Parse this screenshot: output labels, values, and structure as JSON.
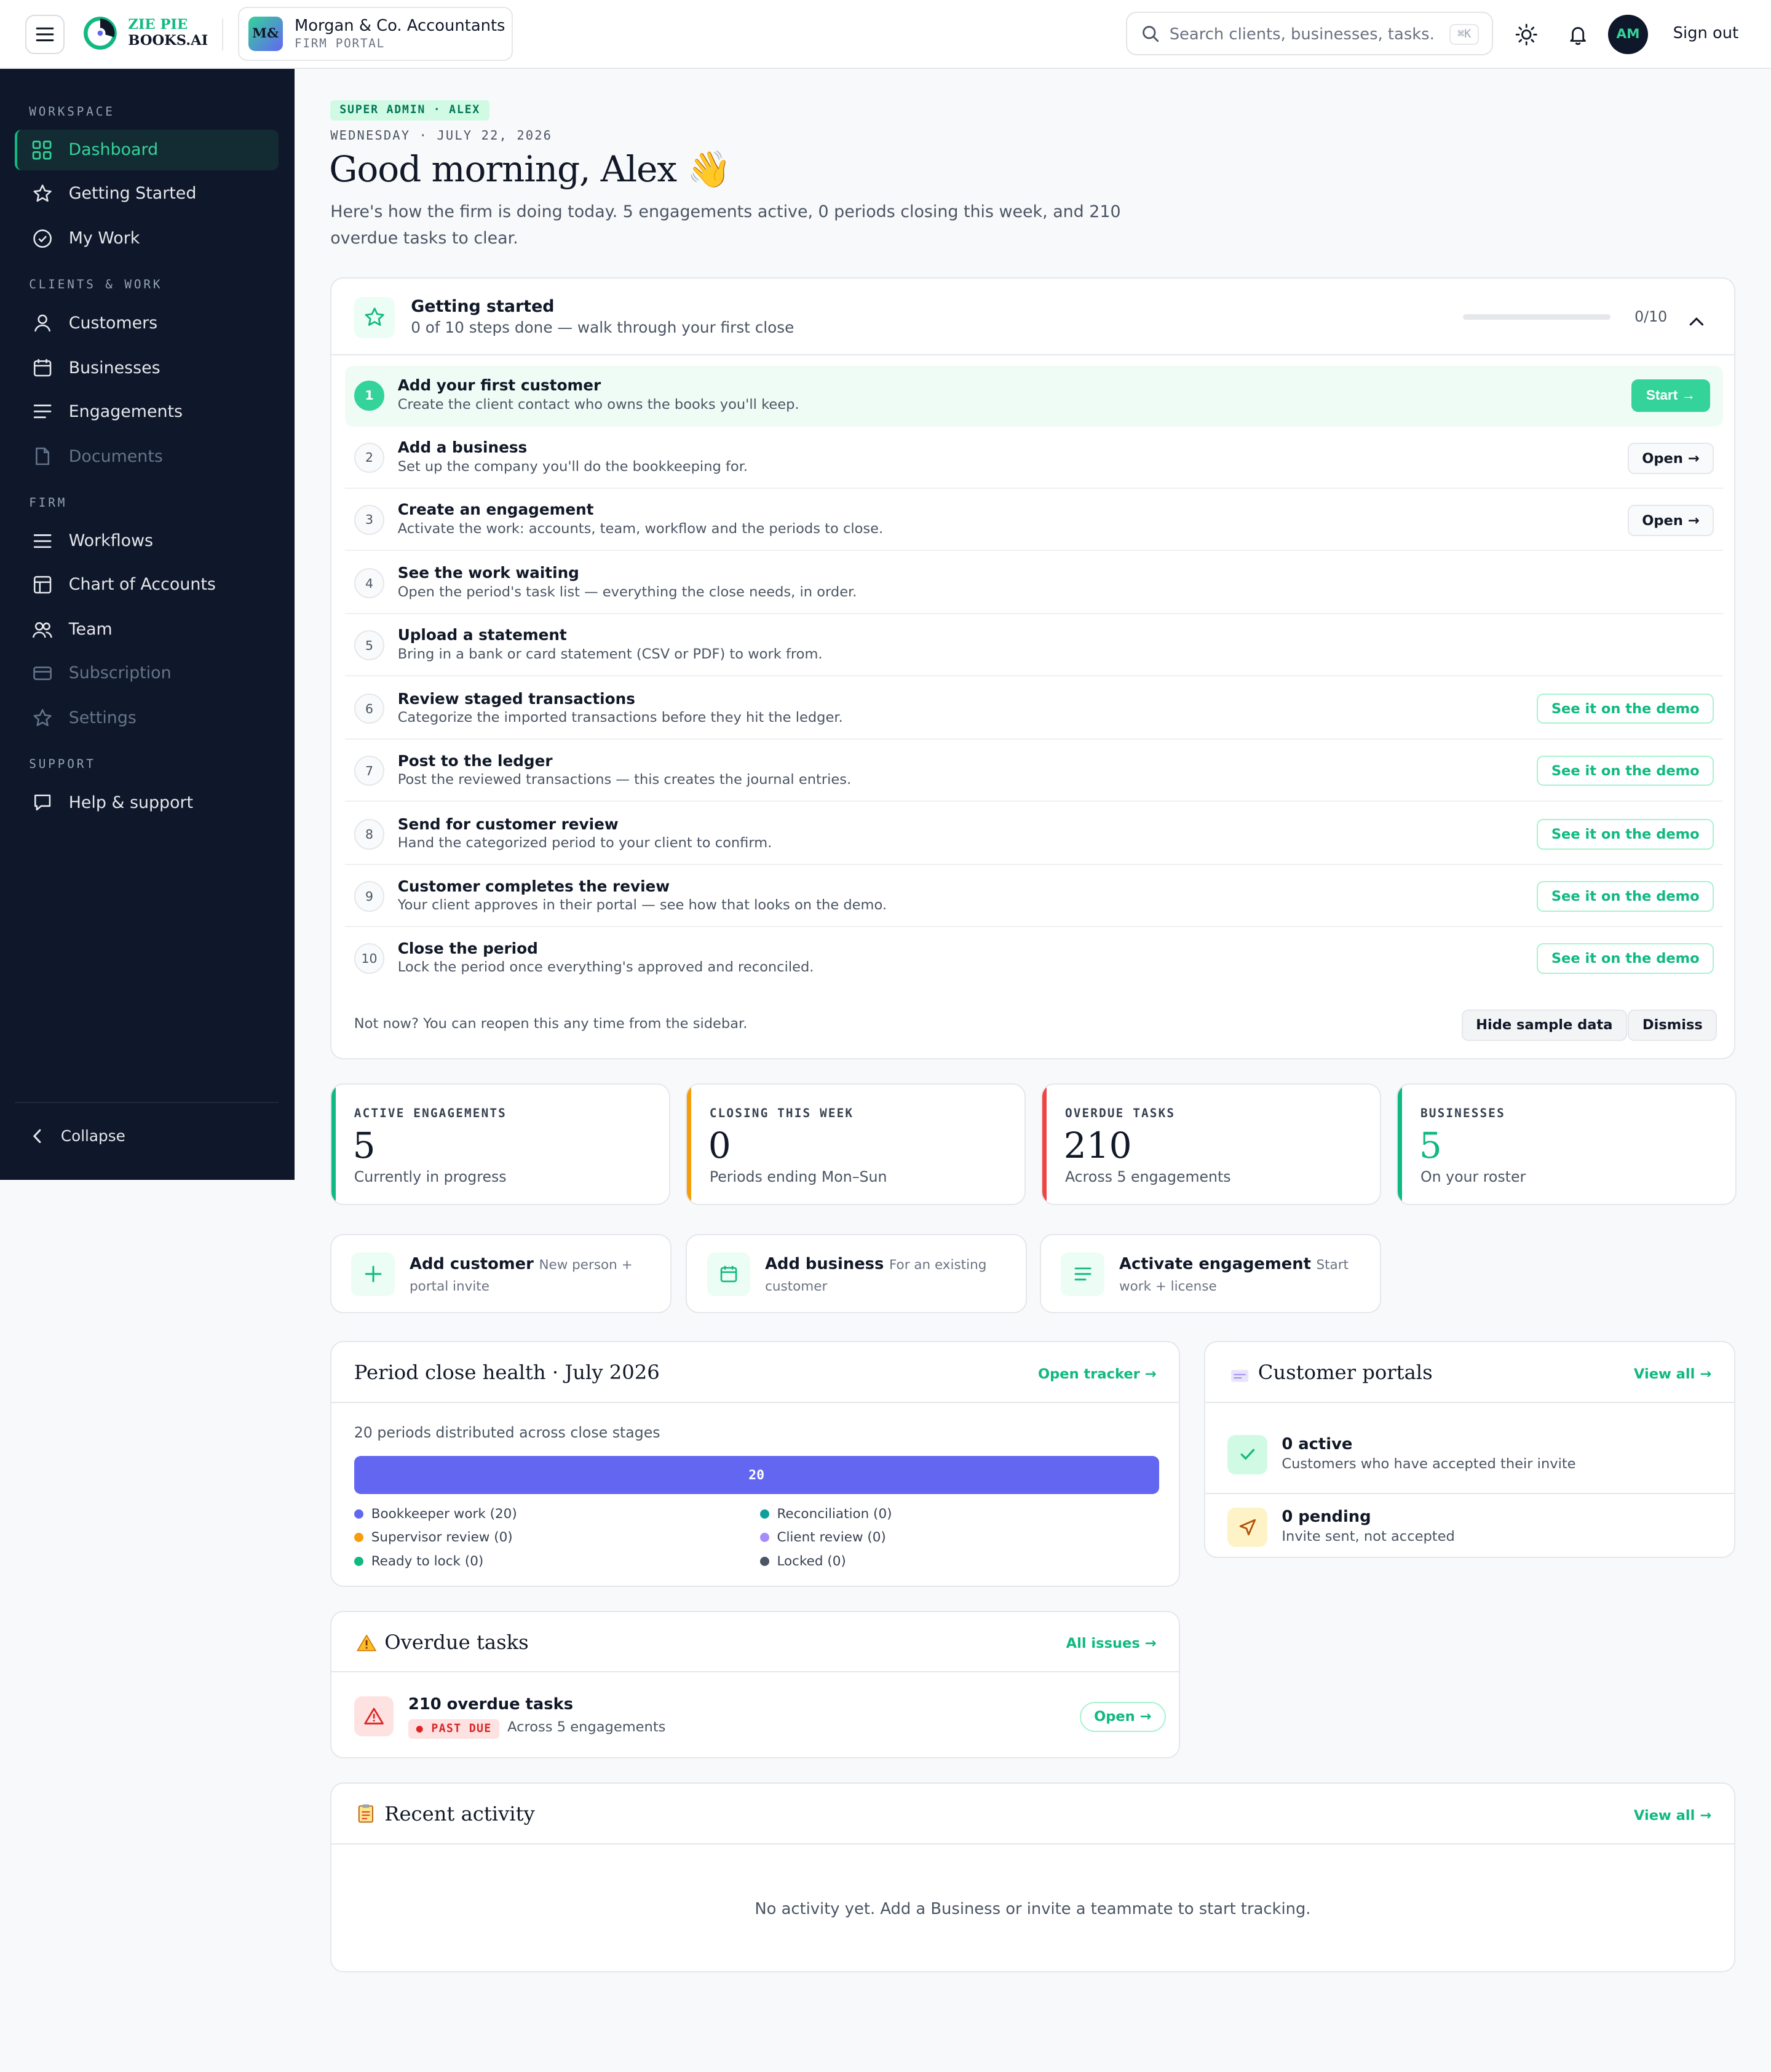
{
  "app": {
    "logo_line1": "ZIE PIE",
    "logo_line2": "BOOKS.AI",
    "firm_badge": "M&",
    "firm_name": "Morgan & Co. Accountants",
    "firm_sub": "FIRM PORTAL",
    "search_placeholder": "Search clients, businesses, tasks...",
    "search_kbd": "⌘K",
    "avatar_initials": "AM",
    "sign_out": "Sign out"
  },
  "sidebar": {
    "sections": {
      "workspace": "WORKSPACE",
      "clients": "CLIENTS & WORK",
      "firm": "FIRM",
      "support": "SUPPORT"
    },
    "items": [
      {
        "label": "Dashboard",
        "icon": "grid-icon"
      },
      {
        "label": "Getting Started",
        "icon": "star-icon"
      },
      {
        "label": "My Work",
        "icon": "check-circle-icon"
      },
      {
        "label": "Customers",
        "icon": "user-icon"
      },
      {
        "label": "Businesses",
        "icon": "calendar-icon"
      },
      {
        "label": "Engagements",
        "icon": "list-icon"
      },
      {
        "label": "Documents",
        "icon": "document-icon"
      },
      {
        "label": "Workflows",
        "icon": "list-icon"
      },
      {
        "label": "Chart of Accounts",
        "icon": "table-icon"
      },
      {
        "label": "Team",
        "icon": "users-icon"
      },
      {
        "label": "Subscription",
        "icon": "card-icon"
      },
      {
        "label": "Settings",
        "icon": "star-icon"
      },
      {
        "label": "Help & support",
        "icon": "chat-icon"
      }
    ],
    "collapse": "Collapse"
  },
  "header": {
    "role_badge": "SUPER ADMIN · ALEX",
    "date": "WEDNESDAY · JULY 22, 2026",
    "greeting": "Good morning, Alex",
    "greeting_emoji": "👋",
    "intro": "Here's how the firm is doing today. 5 engagements active, 0 periods closing this week, and 210 overdue tasks to clear."
  },
  "getting_started": {
    "title": "Getting started",
    "subtitle": "0 of 10 steps done — walk through your first close",
    "progress_fraction": 0,
    "count": "0/10",
    "steps": [
      {
        "num": "1",
        "title": "Add your first customer",
        "desc": "Create the client contact who owns the books you'll keep.",
        "action": "Start →"
      },
      {
        "num": "2",
        "title": "Add a business",
        "desc": "Set up the company you'll do the bookkeeping for.",
        "action": "Open →"
      },
      {
        "num": "3",
        "title": "Create an engagement",
        "desc": "Activate the work: accounts, team, workflow and the periods to close.",
        "action": "Open →"
      },
      {
        "num": "4",
        "title": "See the work waiting",
        "desc": "Open the period's task list — everything the close needs, in order.",
        "action": ""
      },
      {
        "num": "5",
        "title": "Upload a statement",
        "desc": "Bring in a bank or card statement (CSV or PDF) to work from.",
        "action": ""
      },
      {
        "num": "6",
        "title": "Review staged transactions",
        "desc": "Categorize the imported transactions before they hit the ledger.",
        "action": "See it on the demo"
      },
      {
        "num": "7",
        "title": "Post to the ledger",
        "desc": "Post the reviewed transactions — this creates the journal entries.",
        "action": "See it on the demo"
      },
      {
        "num": "8",
        "title": "Send for customer review",
        "desc": "Hand the categorized period to your client to confirm.",
        "action": "See it on the demo"
      },
      {
        "num": "9",
        "title": "Customer completes the review",
        "desc": "Your client approves in their portal — see how that looks on the demo.",
        "action": "See it on the demo"
      },
      {
        "num": "10",
        "title": "Close the period",
        "desc": "Lock the period once everything's approved and reconciled.",
        "action": "See it on the demo"
      }
    ],
    "footer": "Not now? You can reopen this any time from the sidebar.",
    "hide_sample": "Hide sample data",
    "dismiss": "Dismiss"
  },
  "stats": [
    {
      "label": "ACTIVE ENGAGEMENTS",
      "value": "5",
      "sub": "Currently in progress",
      "color": "#10b981"
    },
    {
      "label": "CLOSING THIS WEEK",
      "value": "0",
      "sub": "Periods ending Mon–Sun",
      "color": "#f59e0b"
    },
    {
      "label": "OVERDUE TASKS",
      "value": "210",
      "sub": "Across 5 engagements",
      "color": "#ef4444"
    },
    {
      "label": "BUSINESSES",
      "value": "5",
      "sub": "On your roster",
      "color": "#10b981"
    }
  ],
  "quick_actions": [
    {
      "title": "Add customer",
      "desc": "New person + portal invite"
    },
    {
      "title": "Add business",
      "desc": "For an existing customer"
    },
    {
      "title": "Activate engagement",
      "desc": "Start work + license"
    }
  ],
  "period_close": {
    "title": "Period close health · July 2026",
    "link": "Open tracker →",
    "subtitle": "20 periods distributed across close stages",
    "bar_value": "20",
    "legend": [
      {
        "label": "Bookkeeper work (20)",
        "color": "#6366f1"
      },
      {
        "label": "Reconciliation (0)",
        "color": "#0e9f9a"
      },
      {
        "label": "Supervisor review (0)",
        "color": "#f59e0b"
      },
      {
        "label": "Client review (0)",
        "color": "#a78bfa"
      },
      {
        "label": "Ready to lock (0)",
        "color": "#10b981"
      },
      {
        "label": "Locked (0)",
        "color": "#4b5563"
      }
    ]
  },
  "customer_portals": {
    "title": "Customer portals",
    "link": "View all →",
    "rows": [
      {
        "title": "0 active",
        "desc": "Customers who have accepted their invite"
      },
      {
        "title": "0 pending",
        "desc": "Invite sent, not accepted"
      }
    ]
  },
  "overdue": {
    "title": "Overdue tasks",
    "link": "All issues →",
    "count_title": "210 overdue tasks",
    "badge": "● PAST DUE",
    "sub": "Across 5 engagements",
    "open": "Open →"
  },
  "recent_activity": {
    "title": "Recent activity",
    "link": "View all →",
    "empty": "No activity yet. Add a Business or invite a teammate to start tracking."
  }
}
